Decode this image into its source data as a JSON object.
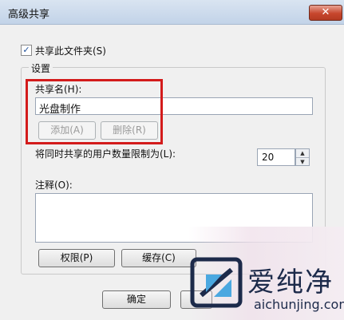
{
  "window": {
    "title": "高级共享",
    "close_glyph": "✕"
  },
  "share_checkbox": {
    "label": "共享此文件夹(S)",
    "checked": true,
    "check_glyph": "✓"
  },
  "settings_group": {
    "label": "设置"
  },
  "share_name": {
    "label": "共享名(H):",
    "value": "光盘制作"
  },
  "buttons": {
    "add": "添加(A)",
    "remove": "删除(R)",
    "permissions": "权限(P)",
    "cache": "缓存(C)",
    "ok": "确定"
  },
  "user_limit": {
    "label": "将同时共享的用户数量限制为(L):",
    "value": "20"
  },
  "comments": {
    "label": "注释(O):",
    "value": ""
  },
  "watermark": {
    "name": "爱纯净",
    "url": "aichunjing.com"
  },
  "colors": {
    "highlight_box": "#d31b1b",
    "close_button": "#c7462d"
  }
}
